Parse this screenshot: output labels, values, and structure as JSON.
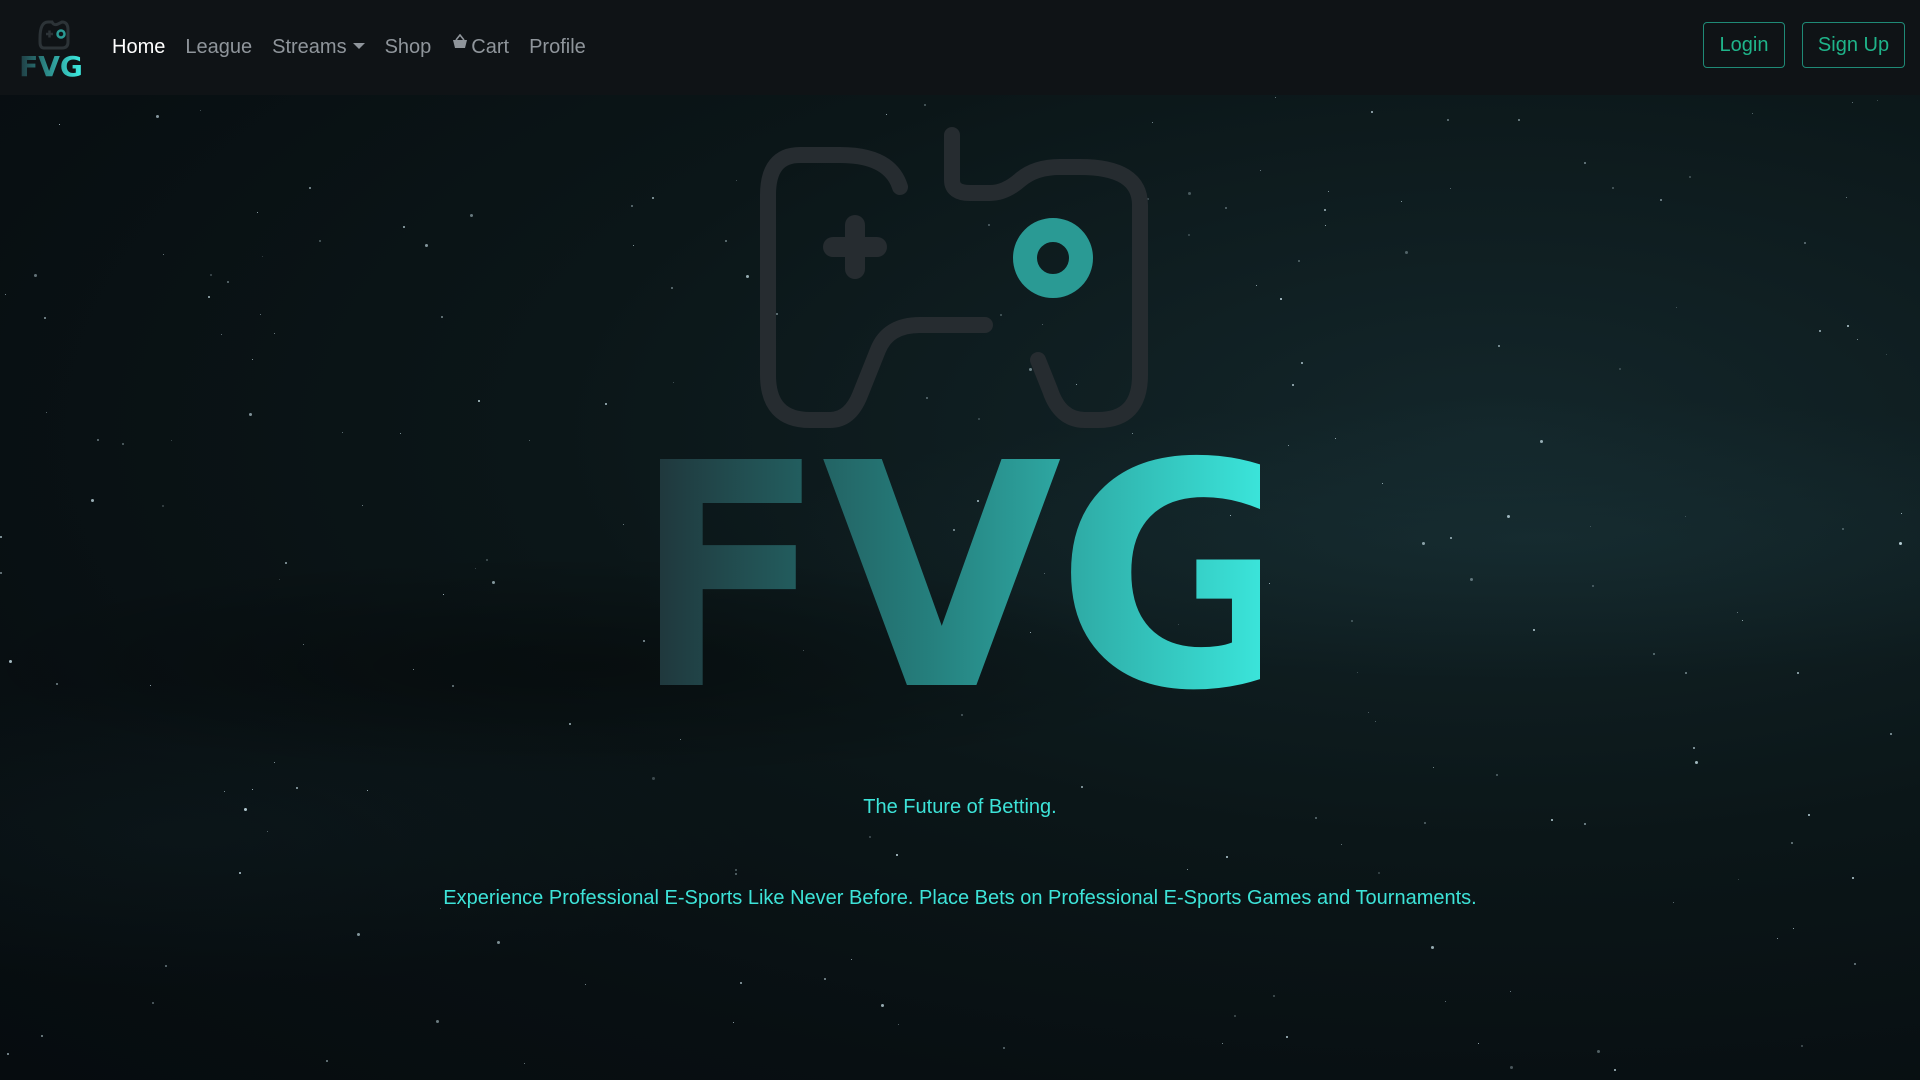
{
  "brand": {
    "logo_text": "FVG",
    "logo_icon": "gamepad-icon"
  },
  "nav": {
    "items": [
      {
        "label": "Home",
        "active": true
      },
      {
        "label": "League",
        "active": false
      },
      {
        "label": "Streams",
        "active": false,
        "dropdown": true
      },
      {
        "label": "Shop",
        "active": false
      },
      {
        "label": "Cart",
        "active": false,
        "icon": "basket-icon"
      },
      {
        "label": "Profile",
        "active": false
      }
    ]
  },
  "auth": {
    "login_label": "Login",
    "signup_label": "Sign Up"
  },
  "hero": {
    "logo_text": "FVG",
    "tagline": "The Future of Betting.",
    "description": "Experience Professional E-Sports Like Never Before. Place Bets on Professional E-Sports Games and Tournaments."
  },
  "colors": {
    "accent": "#3de3d8",
    "button_border": "#1f8a76",
    "button_text": "#1fb48a",
    "navbar_bg": "#0f1316",
    "logo_gradient_start": "#1f2d33",
    "logo_gradient_end": "#3df1e6",
    "controller_outline": "#262c30",
    "controller_accent": "#2a9a94"
  }
}
